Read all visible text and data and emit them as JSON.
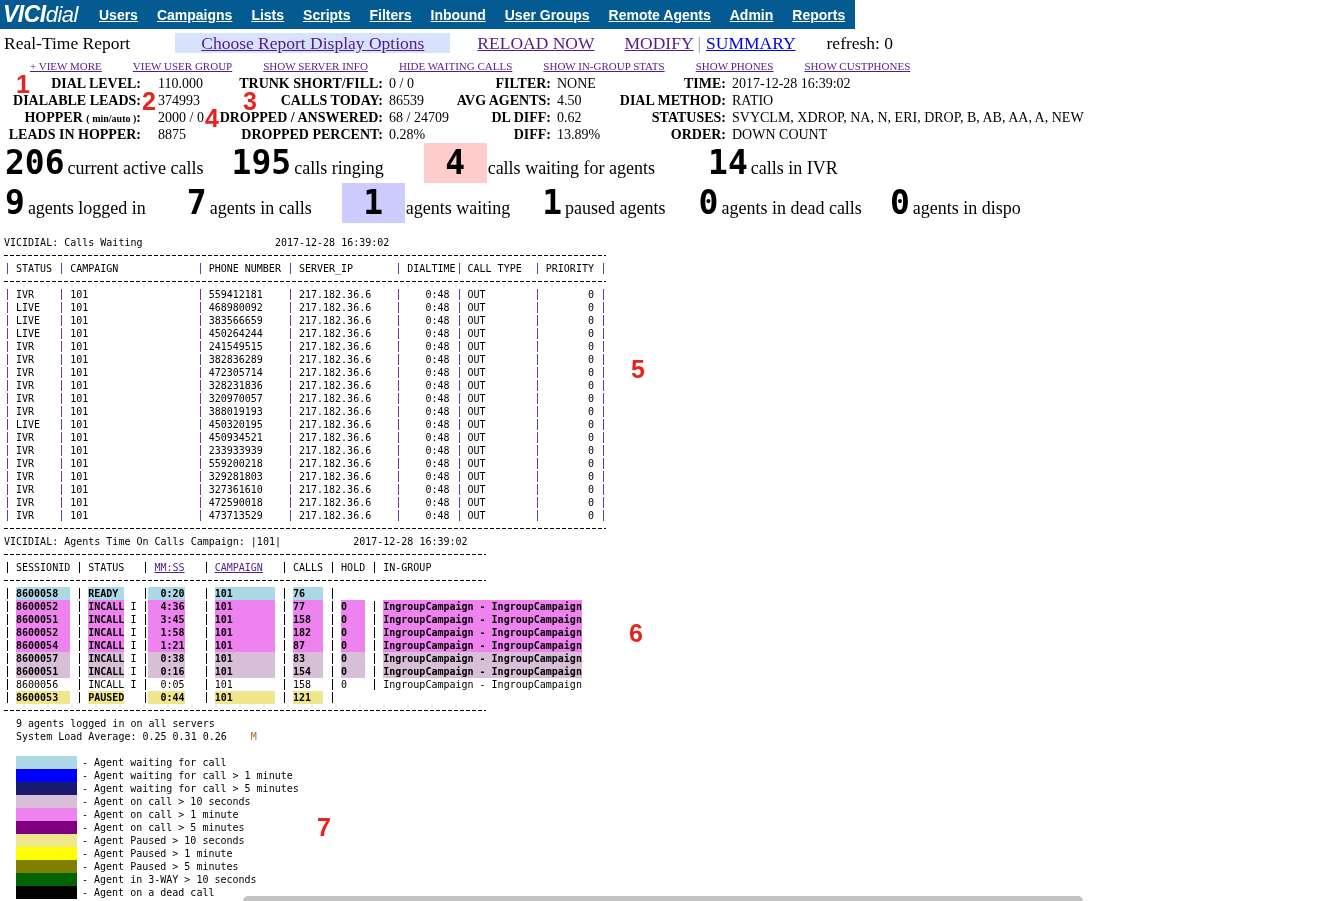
{
  "nav": {
    "logo": "**VICI**dial",
    "items": [
      "Users",
      "Campaigns",
      "Lists",
      "Scripts",
      "Filters",
      "Inbound",
      "User Groups",
      "Remote Agents",
      "Admin",
      "Reports"
    ]
  },
  "report_bar": {
    "title": "Real-Time Report",
    "options_link": {
      "label": "Choose Report Display Options",
      "visited": true
    },
    "actions": [
      {
        "kind": "link",
        "label": "RELOAD NOW",
        "visited": true
      },
      {
        "kind": "link",
        "label": "MODIFY",
        "visited": true
      },
      {
        "kind": "separator",
        "label": "|"
      },
      {
        "kind": "link",
        "label": "SUMMARY",
        "visited": false
      },
      {
        "kind": "text",
        "label": "refresh: 0"
      }
    ]
  },
  "quick_links": [
    {
      "label": "+ VIEW MORE",
      "visited": true
    },
    {
      "label": "VIEW USER GROUP",
      "visited": true
    },
    {
      "label": "SHOW SERVER INFO",
      "visited": true
    },
    {
      "label": "HIDE WAITING CALLS",
      "visited": true
    },
    {
      "label": "SHOW IN-GROUP STATS",
      "visited": true
    },
    {
      "label": "SHOW PHONES",
      "visited": true
    },
    {
      "label": "SHOW CUSTPHONES",
      "visited": true
    }
  ],
  "stats": [
    {
      "cells": [
        {
          "label": "DIAL LEVEL:",
          "value": "110.000"
        },
        {
          "label": "TRUNK SHORT/FILL:",
          "value": "0 / 0"
        },
        {
          "label": "FILTER:",
          "value": "NONE"
        },
        {
          "label": "TIME:",
          "value": "2017-12-28 16:39:02"
        }
      ]
    },
    {
      "cells": [
        {
          "label": "DIALABLE LEADS:",
          "value": "374993"
        },
        {
          "label": "CALLS TODAY:",
          "value": "86539"
        },
        {
          "label": "AVG AGENTS:",
          "value": "4.50"
        },
        {
          "label": "DIAL METHOD:",
          "value": "RATIO"
        }
      ]
    },
    {
      "cells": [
        {
          "label": "HOPPER $_{( min/auto )}$:",
          "value": "2000 / 0"
        },
        {
          "label": "DROPPED / ANSWERED:",
          "value": "68 / 24709"
        },
        {
          "label": "DL DIFF:",
          "value": "0.62"
        },
        {
          "label": "STATUSES:",
          "value": "SVYCLM, XDROP, NA, N, ERI, DROP, B, AB, AA, A, NEW"
        }
      ]
    },
    {
      "cells": [
        {
          "label": "LEADS IN HOPPER:",
          "value": "8875"
        },
        {
          "label": "DROPPED PERCENT:",
          "value": "0.28%"
        },
        {
          "label": "DIFF:",
          "value": "13.89%"
        },
        {
          "label": "ORDER:",
          "value": "DOWN COUNT"
        }
      ]
    }
  ],
  "counter_rows": [
    {
      "items": [
        {
          "count": "206",
          "label": "current active calls"
        },
        {
          "count": "195",
          "label": "calls ringing"
        },
        {
          "count": "4",
          "label": "calls waiting for agents",
          "color": "#ffcccc"
        },
        {
          "count": "14",
          "label": "calls in IVR"
        }
      ]
    },
    {
      "items": [
        {
          "count": "9",
          "label": "agents logged in"
        },
        {
          "count": "7",
          "label": "agents in calls"
        },
        {
          "count": "1",
          "label": "agents waiting",
          "color": "#ccccff"
        },
        {
          "count": "1",
          "label": "paused agents"
        },
        {
          "count": "0",
          "label": "agents in dead calls"
        },
        {
          "count": "0",
          "label": "agents in dispo"
        }
      ]
    }
  ],
  "calls_waiting": {
    "title": "VICIDIAL: Calls Waiting",
    "timestamp": "2017-12-28 16:39:02",
    "columns": [
      "STATUS",
      "CAMPAIGN",
      "PHONE NUMBER",
      "SERVER_IP",
      "DIALTIME",
      "CALL TYPE",
      "PRIORITY"
    ],
    "rows": [
      [
        "IVR",
        "101",
        "559412181",
        "217.182.36.6",
        "0:48",
        "OUT",
        "0"
      ],
      [
        "LIVE",
        "101",
        "468980092",
        "217.182.36.6",
        "0:48",
        "OUT",
        "0"
      ],
      [
        "LIVE",
        "101",
        "383566659",
        "217.182.36.6",
        "0:48",
        "OUT",
        "0"
      ],
      [
        "LIVE",
        "101",
        "450264244",
        "217.182.36.6",
        "0:48",
        "OUT",
        "0"
      ],
      [
        "IVR",
        "101",
        "241549515",
        "217.182.36.6",
        "0:48",
        "OUT",
        "0"
      ],
      [
        "IVR",
        "101",
        "382836289",
        "217.182.36.6",
        "0:48",
        "OUT",
        "0"
      ],
      [
        "IVR",
        "101",
        "472305714",
        "217.182.36.6",
        "0:48",
        "OUT",
        "0"
      ],
      [
        "IVR",
        "101",
        "328231836",
        "217.182.36.6",
        "0:48",
        "OUT",
        "0"
      ],
      [
        "IVR",
        "101",
        "320970057",
        "217.182.36.6",
        "0:48",
        "OUT",
        "0"
      ],
      [
        "IVR",
        "101",
        "388019193",
        "217.182.36.6",
        "0:48",
        "OUT",
        "0"
      ],
      [
        "LIVE",
        "101",
        "450320195",
        "217.182.36.6",
        "0:48",
        "OUT",
        "0"
      ],
      [
        "IVR",
        "101",
        "450934521",
        "217.182.36.6",
        "0:48",
        "OUT",
        "0"
      ],
      [
        "IVR",
        "101",
        "233933939",
        "217.182.36.6",
        "0:48",
        "OUT",
        "0"
      ],
      [
        "IVR",
        "101",
        "559200218",
        "217.182.36.6",
        "0:48",
        "OUT",
        "0"
      ],
      [
        "IVR",
        "101",
        "329281803",
        "217.182.36.6",
        "0:48",
        "OUT",
        "0"
      ],
      [
        "IVR",
        "101",
        "327361610",
        "217.182.36.6",
        "0:48",
        "OUT",
        "0"
      ],
      [
        "IVR",
        "101",
        "472590018",
        "217.182.36.6",
        "0:48",
        "OUT",
        "0"
      ],
      [
        "IVR",
        "101",
        "473713529",
        "217.182.36.6",
        "0:48",
        "OUT",
        "0"
      ]
    ]
  },
  "agents_time": {
    "title": "VICIDIAL: Agents Time On Calls Campaign: |101|",
    "timestamp": "2017-12-28 16:39:02",
    "columns": [
      {
        "label": "SESSIONID",
        "link": false
      },
      {
        "label": "STATUS",
        "link": false
      },
      {
        "label": "MM:SS",
        "link": true
      },
      {
        "label": "CAMPAIGN",
        "link": true
      },
      {
        "label": "CALLS",
        "link": false
      },
      {
        "label": "HOLD",
        "link": false
      },
      {
        "label": "IN-GROUP",
        "link": false
      }
    ],
    "rows": [
      {
        "session_id": "8600058",
        "status": "READY",
        "time": "0:20",
        "campaign": "101",
        "calls": "76",
        "color": "#add8e6"
      },
      {
        "session_id": "8600052",
        "status": "INCALL",
        "call_type": "I",
        "time": "4:36",
        "campaign": "101",
        "calls": "77",
        "hold": "0",
        "in_group": "IngroupCampaign - IngroupCampaign",
        "color": "#ee82ee"
      },
      {
        "session_id": "8600051",
        "status": "INCALL",
        "call_type": "I",
        "time": "3:45",
        "campaign": "101",
        "calls": "158",
        "hold": "0",
        "in_group": "IngroupCampaign - IngroupCampaign",
        "color": "#ee82ee"
      },
      {
        "session_id": "8600052",
        "status": "INCALL",
        "call_type": "I",
        "time": "1:58",
        "campaign": "101",
        "calls": "182",
        "hold": "0",
        "in_group": "IngroupCampaign - IngroupCampaign",
        "color": "#ee82ee"
      },
      {
        "session_id": "8600054",
        "status": "INCALL",
        "call_type": "I",
        "time": "1:21",
        "campaign": "101",
        "calls": "87",
        "hold": "0",
        "in_group": "IngroupCampaign - IngroupCampaign",
        "color": "#ee82ee"
      },
      {
        "session_id": "8600057",
        "status": "INCALL",
        "call_type": "I",
        "time": "0:38",
        "campaign": "101",
        "calls": "83",
        "hold": "0",
        "in_group": "IngroupCampaign - IngroupCampaign",
        "color": "#d8bfd8"
      },
      {
        "session_id": "8600051",
        "status": "INCALL",
        "call_type": "I",
        "time": "0:16",
        "campaign": "101",
        "calls": "154",
        "hold": "0",
        "in_group": "IngroupCampaign - IngroupCampaign",
        "color": "#d8bfd8"
      },
      {
        "session_id": "8600056",
        "status": "INCALL",
        "call_type": "I",
        "time": "0:05",
        "campaign": "101",
        "calls": "158",
        "hold": "0",
        "in_group": "IngroupCampaign - IngroupCampaign"
      },
      {
        "session_id": "8600053",
        "status": "PAUSED",
        "time": "0:44",
        "campaign": "101",
        "calls": "121",
        "color": "#f0e68c"
      }
    ],
    "summary": "9 agents logged in on all servers",
    "load_average": "System Load Average: 0.25 0.31 0.26",
    "load_flag": "M"
  },
  "legend": [
    {
      "color": "#add8e6",
      "label": "- Agent waiting for call"
    },
    {
      "color": "#0000ff",
      "label": "- Agent waiting for call > 1 minute"
    },
    {
      "color": "#191970",
      "label": "- Agent waiting for call > 5 minutes"
    },
    {
      "color": "#d8bfd8",
      "label": "- Agent on call > 10 seconds"
    },
    {
      "color": "#ee82ee",
      "label": "- Agent on call > 1 minute"
    },
    {
      "color": "#800080",
      "label": "- Agent on call > 5 minutes"
    },
    {
      "color": "#f0e68c",
      "label": "- Agent Paused > 10 seconds"
    },
    {
      "color": "#ffff00",
      "label": "- Agent Paused > 1 minute"
    },
    {
      "color": "#808000",
      "label": "- Agent Paused > 5 minutes"
    },
    {
      "color": "#006400",
      "label": "- Agent in 3-WAY > 10 seconds"
    },
    {
      "color": "#000000",
      "label": "- Agent on a dead call"
    }
  ],
  "annotations": [
    {
      "label": "1"
    },
    {
      "label": "2"
    },
    {
      "label": "3"
    },
    {
      "label": "4"
    },
    {
      "label": "5"
    },
    {
      "label": "6"
    },
    {
      "label": "7"
    }
  ]
}
